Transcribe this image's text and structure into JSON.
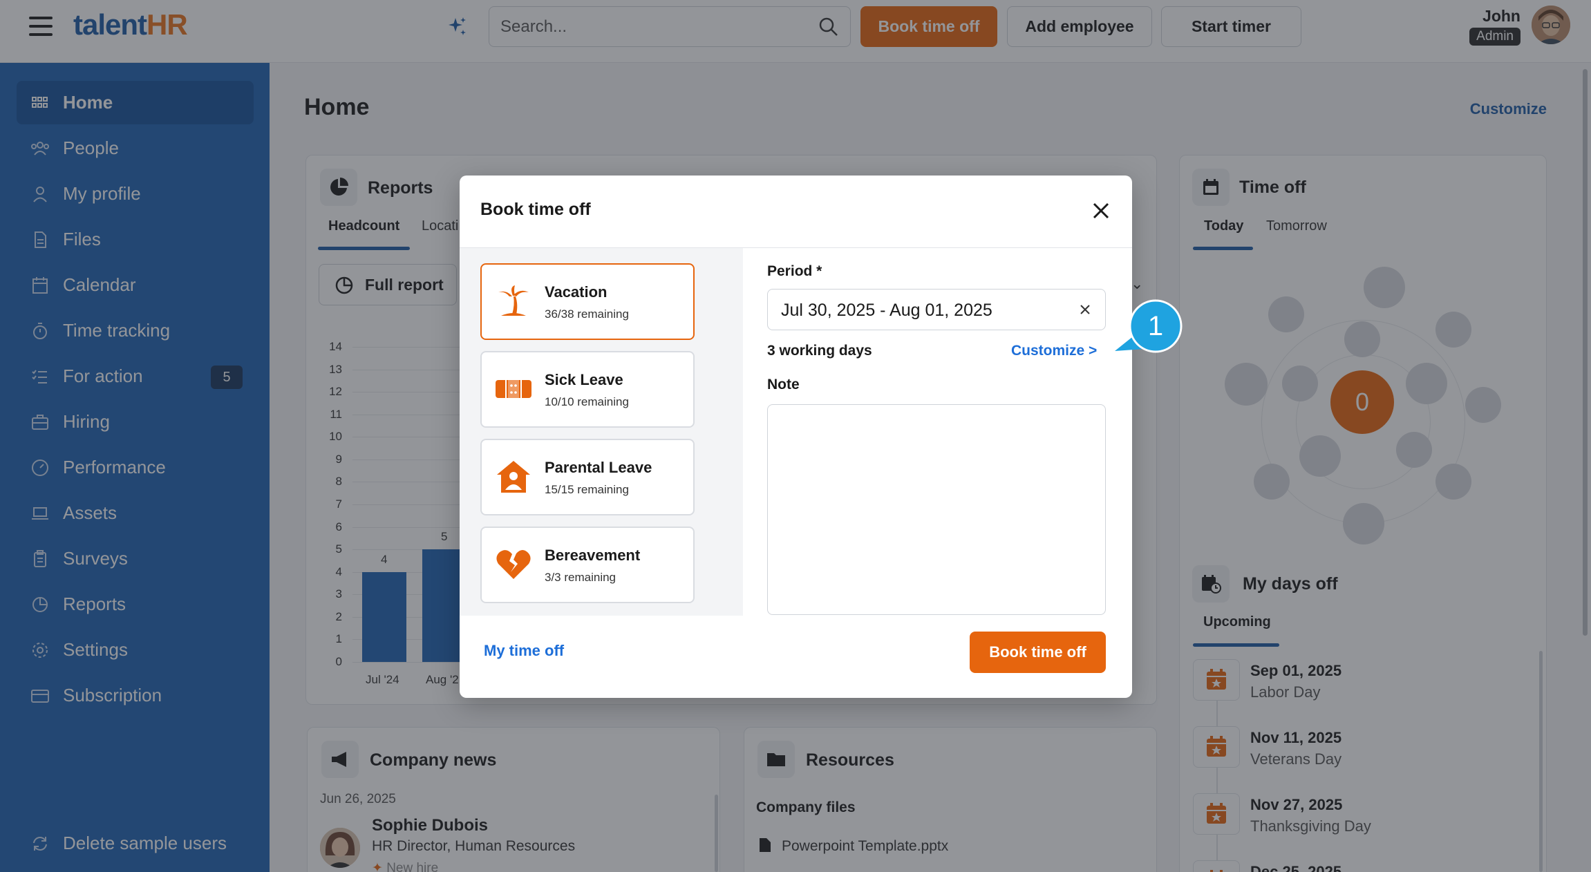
{
  "topbar": {
    "logo_part1": "talent",
    "logo_part2": "HR",
    "search_placeholder": "Search...",
    "book_time_off": "Book time off",
    "add_employee": "Add employee",
    "start_timer": "Start timer",
    "user_name": "John",
    "user_role": "Admin"
  },
  "sidebar": {
    "items": [
      {
        "label": "Home"
      },
      {
        "label": "People"
      },
      {
        "label": "My profile"
      },
      {
        "label": "Files"
      },
      {
        "label": "Calendar"
      },
      {
        "label": "Time tracking"
      },
      {
        "label": "For action",
        "badge": "5"
      },
      {
        "label": "Hiring"
      },
      {
        "label": "Performance"
      },
      {
        "label": "Assets"
      },
      {
        "label": "Surveys"
      },
      {
        "label": "Reports"
      },
      {
        "label": "Settings"
      },
      {
        "label": "Subscription"
      }
    ],
    "bottom": "Delete sample users"
  },
  "main": {
    "title": "Home",
    "customize": "Customize",
    "reports": {
      "title": "Reports",
      "tabs": [
        "Headcount",
        "Locati"
      ],
      "full_report": "Full report",
      "y_ticks": [
        "14",
        "13",
        "12",
        "11",
        "10",
        "9",
        "8",
        "7",
        "6",
        "5",
        "4",
        "3",
        "2",
        "1",
        "0"
      ],
      "x_ticks": [
        "Jul '24",
        "Aug '2"
      ],
      "bar_labels": [
        "4",
        "5"
      ]
    },
    "news": {
      "title": "Company news",
      "date": "Jun 26, 2025",
      "person": "Sophie Dubois",
      "role": "HR Director, Human Resources",
      "tag": "New hire"
    },
    "resources": {
      "title": "Resources",
      "section": "Company files",
      "file": "Powerpoint Template.pptx"
    },
    "timeoff": {
      "title": "Time off",
      "tabs": [
        "Today",
        "Tomorrow"
      ],
      "count": "0"
    },
    "daysoff": {
      "title": "My days off",
      "tab": "Upcoming",
      "items": [
        {
          "date": "Sep 01, 2025",
          "name": "Labor Day"
        },
        {
          "date": "Nov 11, 2025",
          "name": "Veterans Day"
        },
        {
          "date": "Nov 27, 2025",
          "name": "Thanksgiving Day"
        },
        {
          "date": "Dec 25, 2025",
          "name": ""
        }
      ]
    }
  },
  "chart_data": {
    "type": "bar",
    "categories": [
      "Jul '24",
      "Aug '2"
    ],
    "values": [
      4,
      5
    ],
    "title": "",
    "xlabel": "",
    "ylabel": "",
    "ylim": [
      0,
      14
    ]
  },
  "modal": {
    "title": "Book time off",
    "leave_types": [
      {
        "name": "Vacation",
        "remaining": "36/38 remaining"
      },
      {
        "name": "Sick Leave",
        "remaining": "10/10 remaining"
      },
      {
        "name": "Parental Leave",
        "remaining": "15/15 remaining"
      },
      {
        "name": "Bereavement",
        "remaining": "3/3 remaining"
      }
    ],
    "period_label": "Period *",
    "period_value": "Jul 30, 2025 - Aug 01, 2025",
    "working_days": "3 working days",
    "customize": "Customize >",
    "note_label": "Note",
    "my_time_off": "My time off",
    "book": "Book time off"
  },
  "callout": {
    "number": "1"
  },
  "colors": {
    "brand_blue": "#1e63b3",
    "brand_orange": "#e6650e",
    "link_blue": "#1d6ed8",
    "callout": "#1fa3e0"
  }
}
